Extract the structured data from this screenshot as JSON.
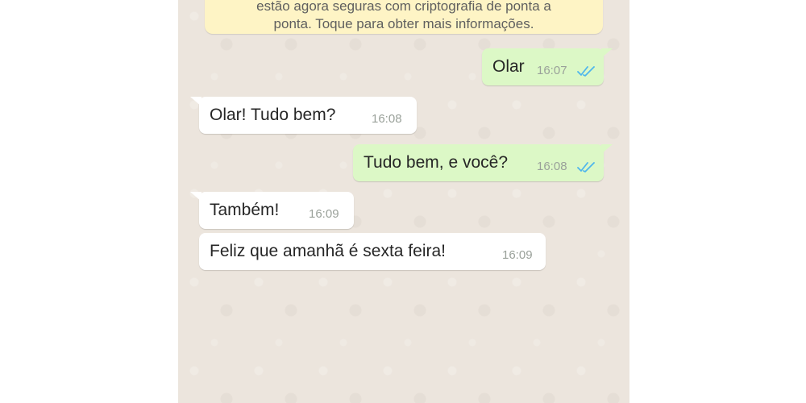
{
  "banner": {
    "line1": "estão agora seguras com criptografia de ponta a",
    "line2": "ponta. Toque para obter mais informações."
  },
  "messages": [
    {
      "direction": "outgoing",
      "text": "Olar",
      "time": "16:07",
      "status_icon": "double-check-icon"
    },
    {
      "direction": "incoming",
      "text": "Olar! Tudo bem?",
      "time": "16:08"
    },
    {
      "direction": "outgoing",
      "text": "Tudo bem, e você?",
      "time": "16:08",
      "status_icon": "double-check-icon"
    },
    {
      "direction": "incoming",
      "text": "Também!",
      "time": "16:09"
    },
    {
      "direction": "incoming",
      "text": "Feliz que amanhã é sexta feira!",
      "time": "16:09"
    }
  ],
  "colors": {
    "chat_background": "#ece5dd",
    "outgoing_bubble": "#dcf8c6",
    "incoming_bubble": "#ffffff",
    "banner": "#fef4c5",
    "read_check": "#4fb6ec"
  }
}
